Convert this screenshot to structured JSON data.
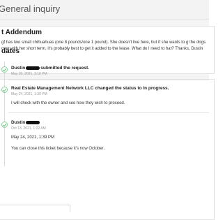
{
  "header": {
    "title": "General inquiry"
  },
  "addendum": {
    "title": "t Addendum",
    "body": "gf has two small chihuahuas (one 8 pounds/one 1 pound). She doesn't live here, but if she wants to g the dogs over with her short term, it's probably best to get it added to the lease. What do I need to hat? Thanks, Dustin"
  },
  "updates": {
    "title": "dates",
    "entries": [
      {
        "author": "Dustin",
        "action": "submitted the request.",
        "date": "May 20, 2021, 3:10 PM",
        "messages": []
      },
      {
        "author": "Real Estate Management Network LLC",
        "action": "changed the status to In progress.",
        "date": "May 24, 2021, 1:39 PM",
        "messages": [
          "I will check with the owner and see how they wish to proceed."
        ]
      },
      {
        "author": "Dustin",
        "action": "",
        "date": "Oct 13, 2021, 1:22 AM",
        "messages": [
          "May 24, 2021, 1:39 PM",
          "You can close this ticket because it's now October."
        ]
      }
    ]
  },
  "colors": {
    "status_icon": "#8ccf9c",
    "background": "#f4f4f4"
  }
}
